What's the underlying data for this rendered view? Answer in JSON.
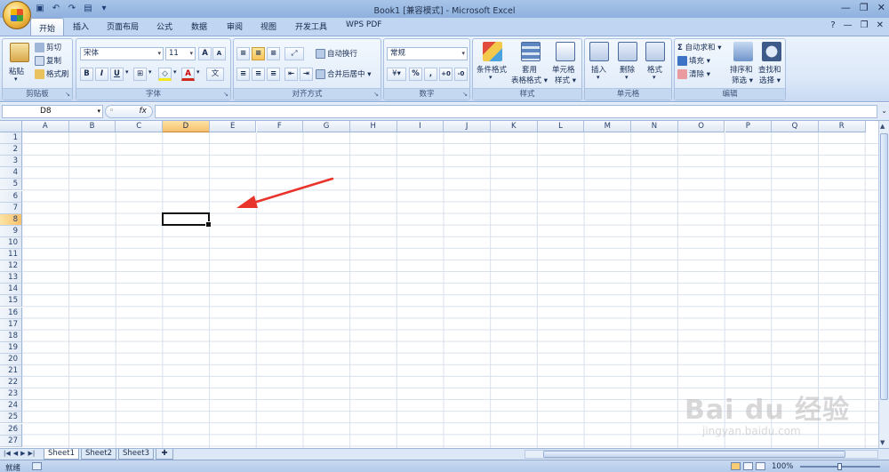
{
  "window": {
    "title": "Book1  [兼容模式] - Microsoft Excel"
  },
  "ribbon_tabs": [
    {
      "label": "开始",
      "active": true
    },
    {
      "label": "插入"
    },
    {
      "label": "页面布局"
    },
    {
      "label": "公式"
    },
    {
      "label": "数据"
    },
    {
      "label": "审阅"
    },
    {
      "label": "视图"
    },
    {
      "label": "开发工具"
    },
    {
      "label": "WPS PDF"
    }
  ],
  "clipboard": {
    "group": "剪贴板",
    "paste": "粘贴",
    "cut": "剪切",
    "copy": "复制",
    "format_painter": "格式刷"
  },
  "font": {
    "group": "字体",
    "font_name": "宋体",
    "font_size": "11",
    "bold": "B",
    "italic": "I",
    "underline": "U",
    "color_letter": "A"
  },
  "alignment": {
    "group": "对齐方式",
    "wrap": "自动换行",
    "merge": "合并后居中"
  },
  "number": {
    "group": "数字",
    "format": "常规",
    "percent": "%",
    "comma": ","
  },
  "styles": {
    "group": "样式",
    "conditional": "条件格式",
    "table_format_1": "套用",
    "table_format_2": "表格格式",
    "cell_styles_1": "单元格",
    "cell_styles_2": "样式"
  },
  "cells": {
    "group": "单元格",
    "insert": "插入",
    "delete": "删除",
    "format": "格式"
  },
  "editing": {
    "group": "编辑",
    "autosum": "自动求和",
    "fill": "填充",
    "clear": "清除",
    "sort_1": "排序和",
    "sort_2": "筛选",
    "find_1": "查找和",
    "find_2": "选择"
  },
  "formula_bar": {
    "name_box": "D8",
    "fx": "fx",
    "value": ""
  },
  "columns": [
    "A",
    "B",
    "C",
    "D",
    "E",
    "F",
    "G",
    "H",
    "I",
    "J",
    "K",
    "L",
    "M",
    "N",
    "O",
    "P",
    "Q",
    "R"
  ],
  "rows": [
    "1",
    "2",
    "3",
    "4",
    "5",
    "6",
    "7",
    "8",
    "9",
    "10",
    "11",
    "12",
    "13",
    "14",
    "15",
    "16",
    "17",
    "18",
    "19",
    "20",
    "21",
    "22",
    "23",
    "24",
    "25",
    "26",
    "27"
  ],
  "selected": {
    "column": "D",
    "row": "8"
  },
  "sheets": [
    {
      "label": "Sheet1",
      "active": true
    },
    {
      "label": "Sheet2"
    },
    {
      "label": "Sheet3"
    }
  ],
  "status": {
    "ready": "就绪",
    "zoom": "100%"
  },
  "watermark": {
    "brand": "Bai du 经验",
    "url": "jingyan.baidu.com"
  },
  "colors": {
    "accent": "#f6c06c",
    "arrow": "#e8342a",
    "ribbon": "#dce8f8"
  }
}
